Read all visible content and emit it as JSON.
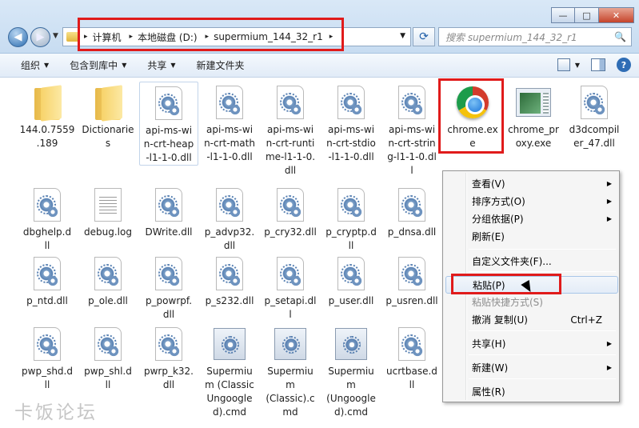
{
  "window": {
    "minimize_glyph": "—",
    "maximize_glyph": "□",
    "close_glyph": "✕"
  },
  "nav": {
    "back_glyph": "◀",
    "forward_glyph": "▶",
    "dropdown_glyph": "▼"
  },
  "address": {
    "breadcrumbs": [
      "计算机",
      "本地磁盘 (D:)",
      "supermium_144_32_r1"
    ],
    "separator": "▸",
    "dropdown_glyph": "▼",
    "refresh_glyph": "⟳"
  },
  "search": {
    "placeholder": "搜索 supermium_144_32_r1",
    "icon": "search-icon",
    "icon_glyph": "🔍"
  },
  "toolbar": {
    "organize": "组织",
    "include_in_library": "包含到库中",
    "share": "共享",
    "new_folder": "新建文件夹",
    "caret": "▼",
    "help_glyph": "?"
  },
  "files": [
    {
      "name": "144.0.7559.189",
      "label": "144.0.7559\n.189",
      "type": "folder"
    },
    {
      "name": "Dictionaries",
      "label": "Dictionarie\ns",
      "type": "folder"
    },
    {
      "name": "api-ms-win-crt-heap-l1-1-0.dll",
      "label": "api-ms-wi\nn-crt-heap\n-l1-1-0.dll",
      "type": "dll"
    },
    {
      "name": "api-ms-win-crt-math-l1-1-0.dll",
      "label": "api-ms-wi\nn-crt-math\n-l1-1-0.dll",
      "type": "dll"
    },
    {
      "name": "api-ms-win-crt-runtime-l1-1-0.dll",
      "label": "api-ms-wi\nn-crt-runti\nme-l1-1-0.\ndll",
      "type": "dll"
    },
    {
      "name": "api-ms-win-crt-stdio-l1-1-0.dll",
      "label": "api-ms-wi\nn-crt-stdio\n-l1-1-0.dll",
      "type": "dll"
    },
    {
      "name": "api-ms-win-crt-string-l1-1-0.dll",
      "label": "api-ms-wi\nn-crt-strin\ng-l1-1-0.dl\nl",
      "type": "dll"
    },
    {
      "name": "chrome.exe",
      "label": "chrome.ex\ne",
      "type": "chrome"
    },
    {
      "name": "chrome_proxy.exe",
      "label": "chrome_pr\noxy.exe",
      "type": "proxy"
    },
    {
      "name": "d3dcompiler_47.dll",
      "label": "d3dcompil\ner_47.dll",
      "type": "dll"
    },
    {
      "name": "dbghelp.dll",
      "label": "dbghelp.d\nll",
      "type": "dll"
    },
    {
      "name": "debug.log",
      "label": "debug.log",
      "type": "log"
    },
    {
      "name": "DWrite.dll",
      "label": "DWrite.dll",
      "type": "dll"
    },
    {
      "name": "p_advp32.dll",
      "label": "p_advp32.\ndll",
      "type": "dll"
    },
    {
      "name": "p_cry32.dll",
      "label": "p_cry32.dll",
      "type": "dll"
    },
    {
      "name": "p_cryptp.dll",
      "label": "p_cryptp.d\nll",
      "type": "dll"
    },
    {
      "name": "p_dnsa.dll",
      "label": "p_dnsa.dll",
      "type": "dll"
    },
    {
      "name": "p_ntd.dll",
      "label": "p_ntd.dll",
      "type": "dll"
    },
    {
      "name": "p_ole.dll",
      "label": "p_ole.dll",
      "type": "dll"
    },
    {
      "name": "p_powrpf.dll",
      "label": "p_powrpf.\ndll",
      "type": "dll"
    },
    {
      "name": "p_s232.dll",
      "label": "p_s232.dll",
      "type": "dll"
    },
    {
      "name": "p_setapi.dll",
      "label": "p_setapi.dl\nl",
      "type": "dll"
    },
    {
      "name": "p_user.dll",
      "label": "p_user.dll",
      "type": "dll"
    },
    {
      "name": "p_usren.dll",
      "label": "p_usren.dll",
      "type": "dll"
    },
    {
      "name": "pwp_shd.dll",
      "label": "pwp_shd.d\nll",
      "type": "dll"
    },
    {
      "name": "pwp_shl.dll",
      "label": "pwp_shl.d\nll",
      "type": "dll"
    },
    {
      "name": "pwrp_k32.dll",
      "label": "pwrp_k32.\ndll",
      "type": "dll"
    },
    {
      "name": "Supermium (Classic Ungoogled).cmd",
      "label": "Supermiu\nm (Classic\nUngoogle\nd).cmd",
      "type": "cmd"
    },
    {
      "name": "Supermium (Classic).cmd",
      "label": "Supermiu\nm\n(Classic).c\nmd",
      "type": "cmd"
    },
    {
      "name": "Supermium (Ungoogled).cmd",
      "label": "Supermiu\nm\n(Ungoogle\nd).cmd",
      "type": "cmd"
    },
    {
      "name": "ucrtbase.dll",
      "label": "ucrtbase.d\nll",
      "type": "dll"
    }
  ],
  "context_menu": {
    "items": [
      {
        "label": "查看(V)",
        "submenu": true
      },
      {
        "label": "排序方式(O)",
        "submenu": true
      },
      {
        "label": "分组依据(P)",
        "submenu": true
      },
      {
        "label": "刷新(E)"
      },
      {
        "label": "自定义文件夹(F)..."
      },
      {
        "label": "粘贴(P)",
        "state": "hover"
      },
      {
        "label": "粘贴快捷方式(S)",
        "state": "disabled"
      },
      {
        "label": "撤消 复制(U)",
        "shortcut": "Ctrl+Z"
      },
      {
        "label": "共享(H)",
        "submenu": true
      },
      {
        "label": "新建(W)",
        "submenu": true
      },
      {
        "label": "属性(R)"
      }
    ],
    "submenu_glyph": "▶"
  },
  "watermark": "卡饭论坛",
  "colors": {
    "highlight_red": "#e01b1b",
    "menu_hover": "#e3ecf7",
    "disabled_text": "#8d8d8d"
  }
}
